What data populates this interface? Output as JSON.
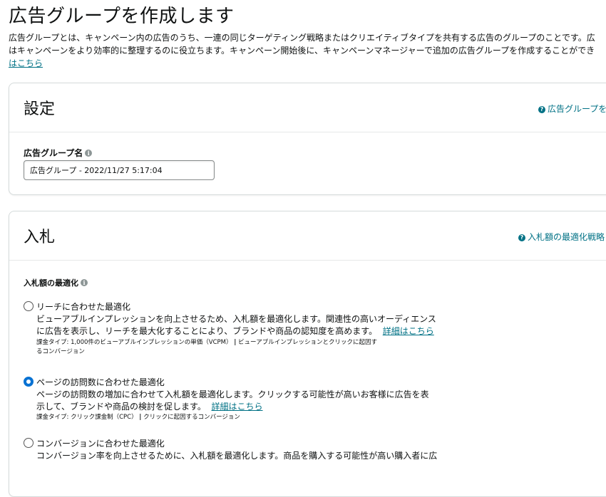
{
  "page": {
    "title": "広告グループを作成します",
    "intro_line1": "広告グループとは、キャンペーン内の広告のうち、一連の同じターゲティング戦略またはクリエイティブタイプを共有する広告のグループのことです。広",
    "intro_line2": "はキャンペーンをより効率的に整理するのに役立ちます。キャンペーン開始後に、キャンペーンマネージャーで追加の広告グループを作成することができ",
    "intro_link": "はこちら"
  },
  "settings": {
    "title": "設定",
    "help_link": "広告グループを",
    "name_label": "広告グループ名",
    "name_value": "広告グループ - 2022/11/27 5:17:04"
  },
  "bidding": {
    "title": "入札",
    "help_link": "入札額の最適化戦略",
    "opt_label": "入札額の最適化",
    "options": [
      {
        "title": "リーチに合わせた最適化",
        "desc_line1": "ビューアブルインプレッションを向上させるため、入札額を最適化します。関連性の高いオーディエンス",
        "desc_line2": "に広告を表示し、リーチを最大化することにより、ブランドや商品の認知度を高めます。",
        "link": "詳細はこちら",
        "meta_line1": "課金タイプ: 1,000件のビューアブルインプレッションの単価（VCPM）",
        "meta_sep": "|",
        "meta_line1b": "ビューアブルインプレッションとクリックに起因す",
        "meta_line2": "るコンバージョン",
        "checked": false
      },
      {
        "title": "ページの訪問数に合わせた最適化",
        "desc_line1": "ページの訪問数の増加に合わせて入札額を最適化します。クリックする可能性が高いお客様に広告を表",
        "desc_line2": "示して、ブランドや商品の検討を促します。",
        "link": "詳細はこちら",
        "meta_line1": "課金タイプ: クリック課金制（CPC）",
        "meta_sep": "|",
        "meta_line1b": "クリックに起因するコンバージョン",
        "checked": true
      },
      {
        "title": "コンバージョンに合わせた最適化",
        "desc_line1": "コンバージョン率を向上させるために、入札額を最適化します。商品を購入する可能性が高い購入者に広",
        "checked": false
      }
    ]
  },
  "icons": {
    "help": "question-icon",
    "info": "info-icon"
  },
  "colors": {
    "link": "#007185",
    "radio_checked": "#0972d3"
  }
}
